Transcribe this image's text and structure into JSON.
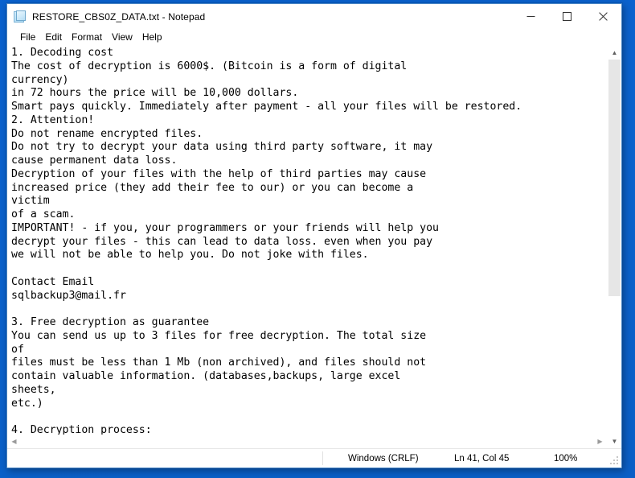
{
  "window": {
    "title": "RESTORE_CBS0Z_DATA.txt - Notepad",
    "icon": "notepad-document-icon",
    "controls": {
      "minimize": "minimize-icon",
      "maximize": "maximize-icon",
      "close": "close-icon"
    }
  },
  "menubar": {
    "items": [
      {
        "label": "File"
      },
      {
        "label": "Edit"
      },
      {
        "label": "Format"
      },
      {
        "label": "View"
      },
      {
        "label": "Help"
      }
    ]
  },
  "document": {
    "filename": "RESTORE_CBS0Z_DATA.txt",
    "lines": [
      "1. Decoding cost",
      "The cost of decryption is 6000$. (Bitcoin is a form of digital",
      "currency)",
      "in 72 hours the price will be 10,000 dollars.",
      "Smart pays quickly. Immediately after payment - all your files will be restored.",
      "2. Attention!",
      "Do not rename encrypted files.",
      "Do not try to decrypt your data using third party software, it may",
      "cause permanent data loss.",
      "Decryption of your files with the help of third parties may cause",
      "increased price (they add their fee to our) or you can become a",
      "victim",
      "of a scam.",
      "IMPORTANT! - if you, your programmers or your friends will help you",
      "decrypt your files - this can lead to data loss. even when you pay",
      "we will not be able to help you. Do not joke with files.",
      "",
      "Contact Email",
      "sqlbackup3@mail.fr",
      "",
      "3. Free decryption as guarantee",
      "You can send us up to 3 files for free decryption. The total size",
      "of",
      "files must be less than 1 Mb (non archived), and files should not",
      "contain valuable information. (databases,backups, large excel",
      "sheets,",
      "etc.)",
      "",
      "4. Decryption process:"
    ],
    "contact_email": "sqlbackup3@mail.fr",
    "ransom_amount": "6000$",
    "ransom_amount_after_72h": "10,000 dollars"
  },
  "scrollbars": {
    "vertical": {
      "up_arrow": "chevron-up-icon",
      "down_arrow": "chevron-down-icon",
      "thumb_top_pct": 0,
      "thumb_height_pct": 63
    },
    "horizontal": {
      "left_arrow": "chevron-left-icon",
      "right_arrow": "chevron-right-icon"
    }
  },
  "statusbar": {
    "line_ending": "Windows (CRLF)",
    "cursor_position": "Ln 41, Col 45",
    "zoom_level": "100%",
    "resize_grip": "resize-grip-icon"
  },
  "colors": {
    "desktop_blue": "#0b63ce",
    "window_border": "#4a86c5",
    "window_bg": "#ffffff",
    "text": "#000000",
    "scrollbar_thumb": "#e6e6e6"
  }
}
